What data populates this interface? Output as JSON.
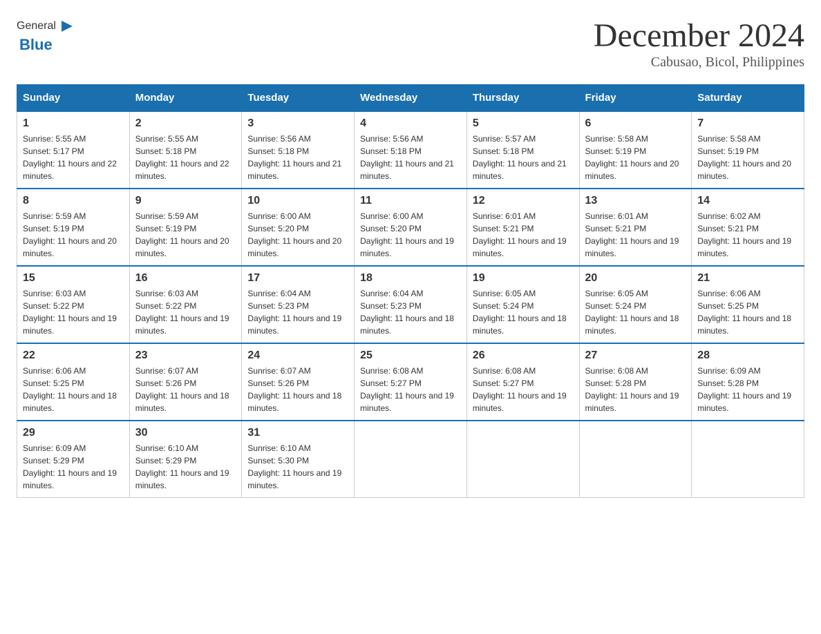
{
  "header": {
    "logo_general": "General",
    "logo_blue": "Blue",
    "month_title": "December 2024",
    "subtitle": "Cabusao, Bicol, Philippines"
  },
  "days_of_week": [
    "Sunday",
    "Monday",
    "Tuesday",
    "Wednesday",
    "Thursday",
    "Friday",
    "Saturday"
  ],
  "weeks": [
    [
      {
        "day": "1",
        "sunrise": "5:55 AM",
        "sunset": "5:17 PM",
        "daylight": "11 hours and 22 minutes."
      },
      {
        "day": "2",
        "sunrise": "5:55 AM",
        "sunset": "5:18 PM",
        "daylight": "11 hours and 22 minutes."
      },
      {
        "day": "3",
        "sunrise": "5:56 AM",
        "sunset": "5:18 PM",
        "daylight": "11 hours and 21 minutes."
      },
      {
        "day": "4",
        "sunrise": "5:56 AM",
        "sunset": "5:18 PM",
        "daylight": "11 hours and 21 minutes."
      },
      {
        "day": "5",
        "sunrise": "5:57 AM",
        "sunset": "5:18 PM",
        "daylight": "11 hours and 21 minutes."
      },
      {
        "day": "6",
        "sunrise": "5:58 AM",
        "sunset": "5:19 PM",
        "daylight": "11 hours and 20 minutes."
      },
      {
        "day": "7",
        "sunrise": "5:58 AM",
        "sunset": "5:19 PM",
        "daylight": "11 hours and 20 minutes."
      }
    ],
    [
      {
        "day": "8",
        "sunrise": "5:59 AM",
        "sunset": "5:19 PM",
        "daylight": "11 hours and 20 minutes."
      },
      {
        "day": "9",
        "sunrise": "5:59 AM",
        "sunset": "5:19 PM",
        "daylight": "11 hours and 20 minutes."
      },
      {
        "day": "10",
        "sunrise": "6:00 AM",
        "sunset": "5:20 PM",
        "daylight": "11 hours and 20 minutes."
      },
      {
        "day": "11",
        "sunrise": "6:00 AM",
        "sunset": "5:20 PM",
        "daylight": "11 hours and 19 minutes."
      },
      {
        "day": "12",
        "sunrise": "6:01 AM",
        "sunset": "5:21 PM",
        "daylight": "11 hours and 19 minutes."
      },
      {
        "day": "13",
        "sunrise": "6:01 AM",
        "sunset": "5:21 PM",
        "daylight": "11 hours and 19 minutes."
      },
      {
        "day": "14",
        "sunrise": "6:02 AM",
        "sunset": "5:21 PM",
        "daylight": "11 hours and 19 minutes."
      }
    ],
    [
      {
        "day": "15",
        "sunrise": "6:03 AM",
        "sunset": "5:22 PM",
        "daylight": "11 hours and 19 minutes."
      },
      {
        "day": "16",
        "sunrise": "6:03 AM",
        "sunset": "5:22 PM",
        "daylight": "11 hours and 19 minutes."
      },
      {
        "day": "17",
        "sunrise": "6:04 AM",
        "sunset": "5:23 PM",
        "daylight": "11 hours and 19 minutes."
      },
      {
        "day": "18",
        "sunrise": "6:04 AM",
        "sunset": "5:23 PM",
        "daylight": "11 hours and 18 minutes."
      },
      {
        "day": "19",
        "sunrise": "6:05 AM",
        "sunset": "5:24 PM",
        "daylight": "11 hours and 18 minutes."
      },
      {
        "day": "20",
        "sunrise": "6:05 AM",
        "sunset": "5:24 PM",
        "daylight": "11 hours and 18 minutes."
      },
      {
        "day": "21",
        "sunrise": "6:06 AM",
        "sunset": "5:25 PM",
        "daylight": "11 hours and 18 minutes."
      }
    ],
    [
      {
        "day": "22",
        "sunrise": "6:06 AM",
        "sunset": "5:25 PM",
        "daylight": "11 hours and 18 minutes."
      },
      {
        "day": "23",
        "sunrise": "6:07 AM",
        "sunset": "5:26 PM",
        "daylight": "11 hours and 18 minutes."
      },
      {
        "day": "24",
        "sunrise": "6:07 AM",
        "sunset": "5:26 PM",
        "daylight": "11 hours and 18 minutes."
      },
      {
        "day": "25",
        "sunrise": "6:08 AM",
        "sunset": "5:27 PM",
        "daylight": "11 hours and 19 minutes."
      },
      {
        "day": "26",
        "sunrise": "6:08 AM",
        "sunset": "5:27 PM",
        "daylight": "11 hours and 19 minutes."
      },
      {
        "day": "27",
        "sunrise": "6:08 AM",
        "sunset": "5:28 PM",
        "daylight": "11 hours and 19 minutes."
      },
      {
        "day": "28",
        "sunrise": "6:09 AM",
        "sunset": "5:28 PM",
        "daylight": "11 hours and 19 minutes."
      }
    ],
    [
      {
        "day": "29",
        "sunrise": "6:09 AM",
        "sunset": "5:29 PM",
        "daylight": "11 hours and 19 minutes."
      },
      {
        "day": "30",
        "sunrise": "6:10 AM",
        "sunset": "5:29 PM",
        "daylight": "11 hours and 19 minutes."
      },
      {
        "day": "31",
        "sunrise": "6:10 AM",
        "sunset": "5:30 PM",
        "daylight": "11 hours and 19 minutes."
      },
      null,
      null,
      null,
      null
    ]
  ]
}
